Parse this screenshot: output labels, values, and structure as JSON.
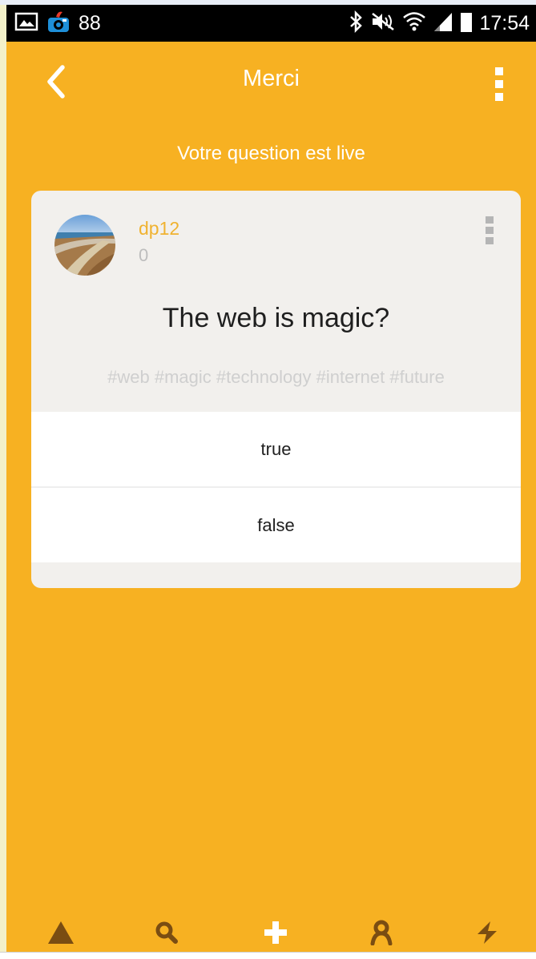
{
  "status_bar": {
    "notification_count": "88",
    "time": "17:54",
    "icons": [
      "gallery-icon",
      "app-icon",
      "bluetooth-icon",
      "mute-icon",
      "wifi-icon",
      "signal-icon",
      "battery-icon"
    ]
  },
  "header": {
    "title": "Merci",
    "back_icon": "chevron-left-icon",
    "menu_icon": "vertical-dots-icon"
  },
  "subtitle": "Votre question est live",
  "card": {
    "username": "dp12",
    "score": "0",
    "question": "The web is magic?",
    "tags": "#web #magic #technology #internet #future",
    "answers": [
      {
        "label": "true"
      },
      {
        "label": "false"
      }
    ]
  },
  "bottom_nav": {
    "items": [
      "triangle-icon",
      "search-icon",
      "plus-icon",
      "profile-icon",
      "lightning-icon"
    ],
    "active_color": "#ffffff",
    "inactive_color": "#7a4d12"
  },
  "colors": {
    "accent": "#f7b122",
    "card": "#f2f0ed",
    "username": "#f0b230"
  }
}
